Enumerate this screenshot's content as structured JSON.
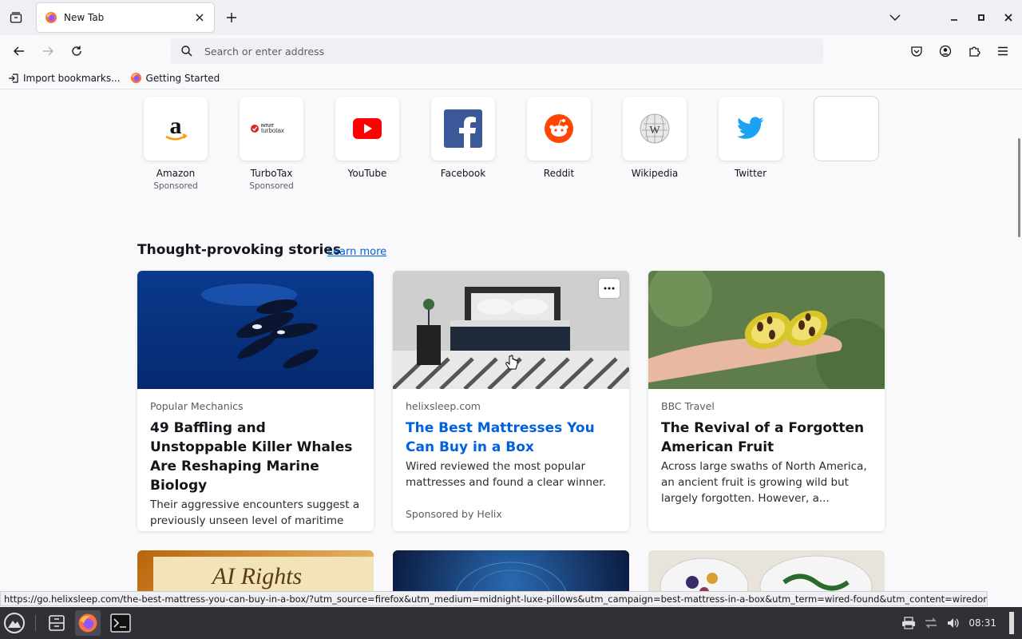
{
  "browser": {
    "tab": {
      "title": "New Tab"
    },
    "urlbar": {
      "placeholder": "Search or enter address"
    },
    "bookmarks": [
      {
        "label": "Import bookmarks...",
        "icon": "import-icon"
      },
      {
        "label": "Getting Started",
        "icon": "firefox-icon"
      }
    ]
  },
  "shortcuts": [
    {
      "label": "Amazon",
      "sub": "Sponsored",
      "icon": "amazon-logo"
    },
    {
      "label": "TurboTax",
      "sub": "Sponsored",
      "icon": "turbotax-logo"
    },
    {
      "label": "YouTube",
      "sub": "",
      "icon": "youtube-logo"
    },
    {
      "label": "Facebook",
      "sub": "",
      "icon": "facebook-logo"
    },
    {
      "label": "Reddit",
      "sub": "",
      "icon": "reddit-logo"
    },
    {
      "label": "Wikipedia",
      "sub": "",
      "icon": "wikipedia-logo"
    },
    {
      "label": "Twitter",
      "sub": "",
      "icon": "twitter-logo"
    },
    {
      "label": "",
      "sub": "",
      "icon": ""
    }
  ],
  "stories": {
    "title": "Thought-provoking stories",
    "learn_more": "Learn more",
    "cards": [
      {
        "source": "Popular Mechanics",
        "title": "49 Baffling and Unstoppable Killer Whales Are Reshaping Marine Biology",
        "desc": "Their aggressive encounters suggest a previously unseen level of maritime dominance."
      },
      {
        "source": "helixsleep.com",
        "title": "The Best Mattresses You Can Buy in a Box",
        "desc": "Wired reviewed the most popular mattresses and found a clear winner.",
        "sponsor": "Sponsored by Helix"
      },
      {
        "source": "BBC Travel",
        "title": "The Revival of a Forgotten American Fruit",
        "desc": "Across large swaths of North America, an ancient fruit is growing wild but largely forgotten. However, a..."
      }
    ],
    "next_row_text": "AI Rights"
  },
  "status_url": "https://go.helixsleep.com/the-best-mattress-you-can-buy-in-a-box/?utm_source=firefox&utm_medium=midnight-luxe-pillows&utm_campaign=best-mattress-in-a-box&utm_term=wired-found&utm_content=wiredonhelix",
  "taskbar": {
    "clock": "08:31"
  }
}
